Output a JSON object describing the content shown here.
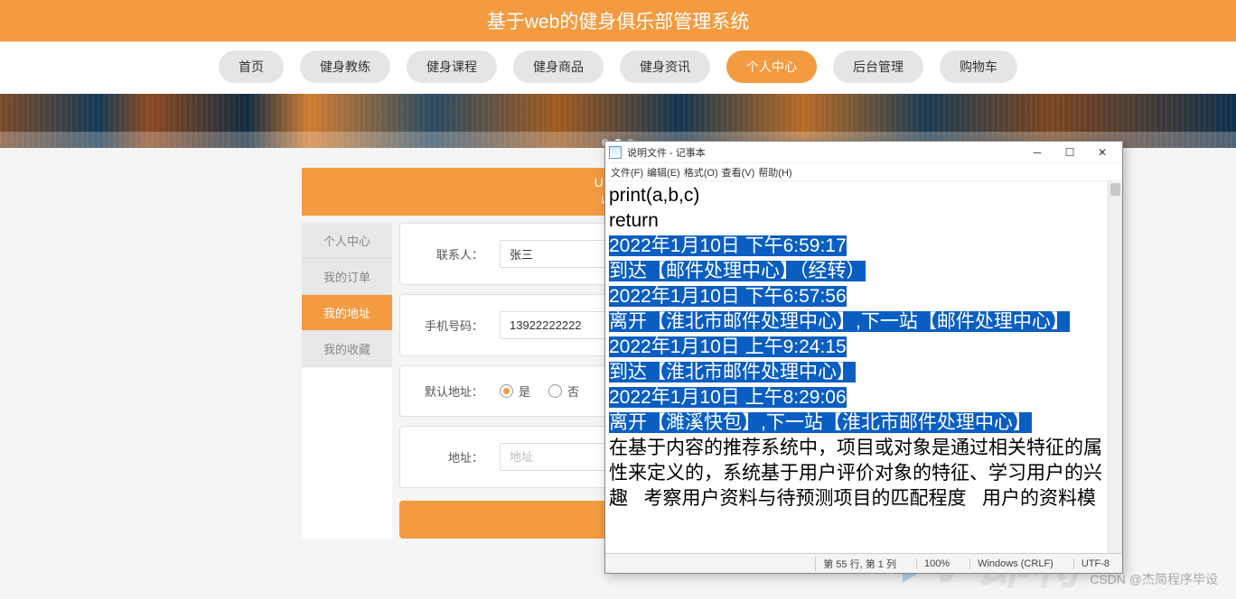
{
  "header": {
    "title": "基于web的健身俱乐部管理系统"
  },
  "nav": {
    "items": [
      "首页",
      "健身教练",
      "健身课程",
      "健身商品",
      "健身资讯",
      "个人中心",
      "后台管理",
      "购物车"
    ],
    "active": 5
  },
  "userbar": {
    "line1": "USER /",
    "line2": "收货"
  },
  "sidebar": {
    "items": [
      "个人中心",
      "我的订单",
      "我的地址",
      "我的收藏"
    ],
    "active": 2
  },
  "form": {
    "contact": {
      "label": "联系人：",
      "value": "张三"
    },
    "phone": {
      "label": "手机号码：",
      "value": "13922222222"
    },
    "def": {
      "label": "默认地址：",
      "opt_yes": "是",
      "opt_no": "否",
      "selected": "yes"
    },
    "addr": {
      "label": "地址：",
      "placeholder": "地址",
      "value": ""
    }
  },
  "watermark": {
    "text": "CSDN @杰简程序毕设",
    "logo": "V 即将"
  },
  "notepad": {
    "title": "说明文件 - 记事本",
    "menus": {
      "file": "文件(F)",
      "edit": "编辑(E)",
      "format": "格式(O)",
      "view": "查看(V)",
      "help": "帮助(H)"
    },
    "content": {
      "l1": "print(a,b,c)",
      "l2": "",
      "l3": "return",
      "l4": "",
      "l5": "",
      "h1": "2022年1月10日 下午6:59:17",
      "h2": "到达【邮件处理中心】（经转）",
      "h3": "2022年1月10日 下午6:57:56",
      "h4": "离开【淮北市邮件处理中心】,下一站【邮件处理中心】",
      "h5": "2022年1月10日 上午9:24:15",
      "h6": "到达【淮北市邮件处理中心】",
      "h7": "2022年1月10日 上午8:29:06",
      "h8": "离开【濉溪快包】,下一站【淮北市邮件处理中心】",
      "p1": "在基于内容的推荐系统中，项目或对象是通过相关特征的属",
      "p2": "性来定义的，系统基于用户评价对象的特征、学习用户的兴",
      "p3": "趣   考察用户资料与待预测项目的匹配程度   用户的资料模"
    },
    "status": {
      "pos": "第 55 行, 第 1 列",
      "zoom": "100%",
      "eol": "Windows (CRLF)",
      "enc": "UTF-8"
    }
  }
}
